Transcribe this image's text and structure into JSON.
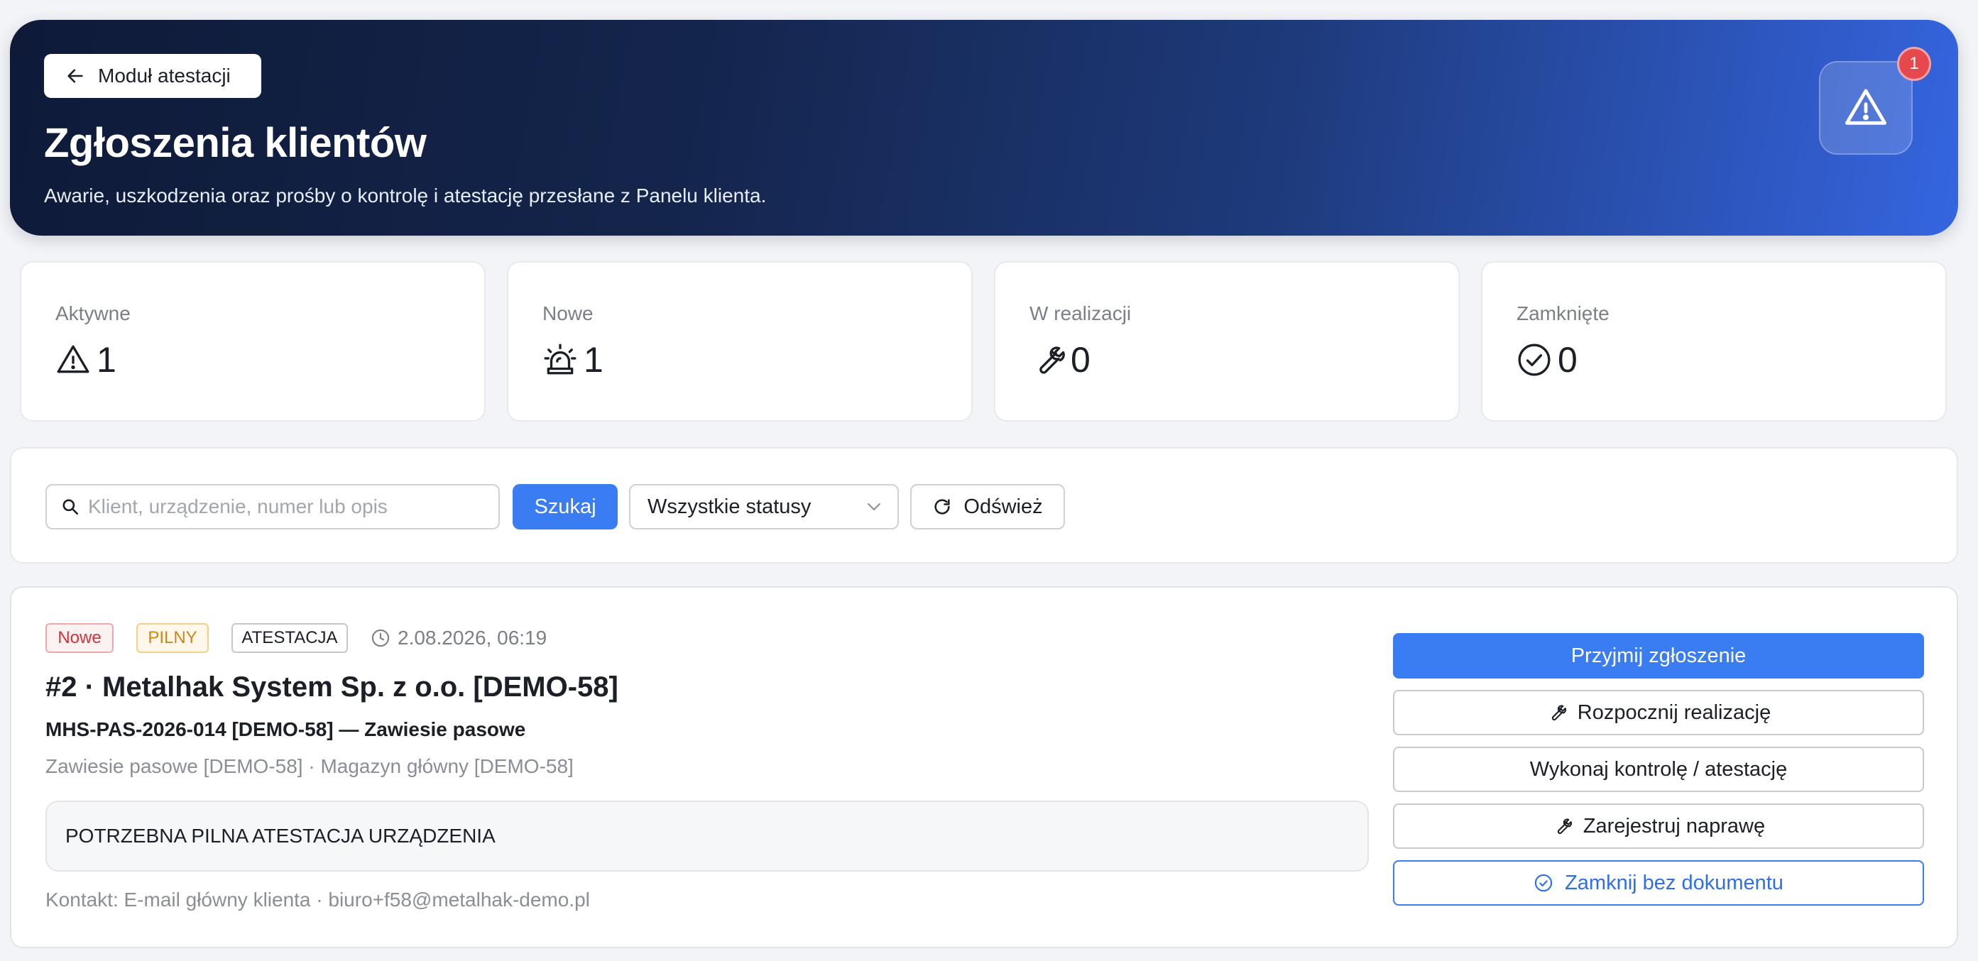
{
  "header": {
    "back_label": "Moduł atestacji",
    "title": "Zgłoszenia klientów",
    "subtitle": "Awarie, uszkodzenia oraz prośby o kontrolę i atestację przesłane z Panelu klienta.",
    "alert_icon": "warning-triangle-icon",
    "alert_badge": "1"
  },
  "stats": [
    {
      "label": "Aktywne",
      "value": "1",
      "icon": "warning-triangle-icon"
    },
    {
      "label": "Nowe",
      "value": "1",
      "icon": "siren-icon"
    },
    {
      "label": "W realizacji",
      "value": "0",
      "icon": "wrench-icon"
    },
    {
      "label": "Zamknięte",
      "value": "0",
      "icon": "check-circle-icon"
    }
  ],
  "filters": {
    "search_placeholder": "Klient, urządzenie, numer lub opis",
    "search_value": "",
    "search_button": "Szukaj",
    "status_selected": "Wszystkie statusy",
    "refresh_button": "Odśwież"
  },
  "ticket": {
    "status_tag": "Nowe",
    "priority_tag": "PILNY",
    "type_tag": "ATESTACJA",
    "date": "2.08.2026, 06:19",
    "title": "#2 · Metalhak System Sp. z o.o. [DEMO-58]",
    "device": "MHS-PAS-2026-014 [DEMO-58] — Zawiesie pasowe",
    "meta": "Zawiesie pasowe [DEMO-58] · Magazyn główny [DEMO-58]",
    "description": "POTRZEBNA PILNA ATESTACJA URZĄDZENIA",
    "contact": "Kontakt: E-mail główny klienta · biuro+f58@metalhak-demo.pl",
    "actions": {
      "accept": "Przyjmij zgłoszenie",
      "start": "Rozpocznij realizację",
      "inspect": "Wykonaj kontrolę / atestację",
      "repair": "Zarejestruj naprawę",
      "close": "Zamknij bez dokumentu"
    }
  },
  "colors": {
    "accent": "#3a7cf2",
    "header_dark": "#0e1a38",
    "header_light": "#3565e0",
    "badge_red": "#e5484d",
    "tag_new": "#d0343b",
    "tag_urgent": "#c9871c"
  }
}
